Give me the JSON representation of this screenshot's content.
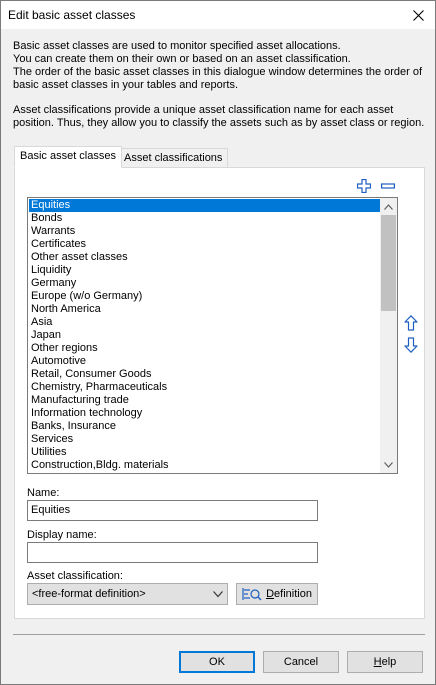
{
  "window": {
    "title": "Edit basic asset classes"
  },
  "intro": {
    "line1": "Basic asset classes are used to monitor specified asset allocations.",
    "line2": "You can create them on their own or based on an asset classification.",
    "line3": "The order of the basic asset classes in this dialogue window determines the order of",
    "line4": "basic asset classes in your tables and reports.",
    "line5": "Asset classifications provide a unique asset classification name for each asset",
    "line6": "position. Thus, they allow you to classify the assets such as by asset class or region."
  },
  "tabs": [
    {
      "label": "Basic asset classes",
      "active": true
    },
    {
      "label": "Asset classifications",
      "active": false
    }
  ],
  "list": {
    "selected_index": 0,
    "items": [
      "Equities",
      "Bonds",
      "Warrants",
      "Certificates",
      "Other asset classes",
      "Liquidity",
      "Germany",
      "Europe (w/o Germany)",
      "North America",
      "Asia",
      "Japan",
      "Other regions",
      "Automotive",
      "Retail, Consumer Goods",
      "Chemistry, Pharmaceuticals",
      "Manufacturing trade",
      "Information technology",
      "Banks, Insurance",
      "Services",
      "Utilities",
      "Construction,Bldg. materials"
    ]
  },
  "form": {
    "name_label": "Name:",
    "name_value": "Equities",
    "display_name_label": "Display name:",
    "display_name_value": "",
    "classification_label": "Asset classification:",
    "classification_value": "<free-format definition>"
  },
  "buttons": {
    "definition": "Definition",
    "definition_mnemonic": "D",
    "definition_rest": "efinition",
    "ok": "OK",
    "cancel": "Cancel",
    "help_mnemonic": "H",
    "help_rest": "elp"
  },
  "icons": {
    "add": "plus-icon",
    "remove": "minus-icon",
    "move_up": "arrow-up-icon",
    "move_down": "arrow-down-icon",
    "definition": "definition-icon"
  },
  "colors": {
    "accent": "#0078d7",
    "icon_blue": "#1f5fbf"
  }
}
